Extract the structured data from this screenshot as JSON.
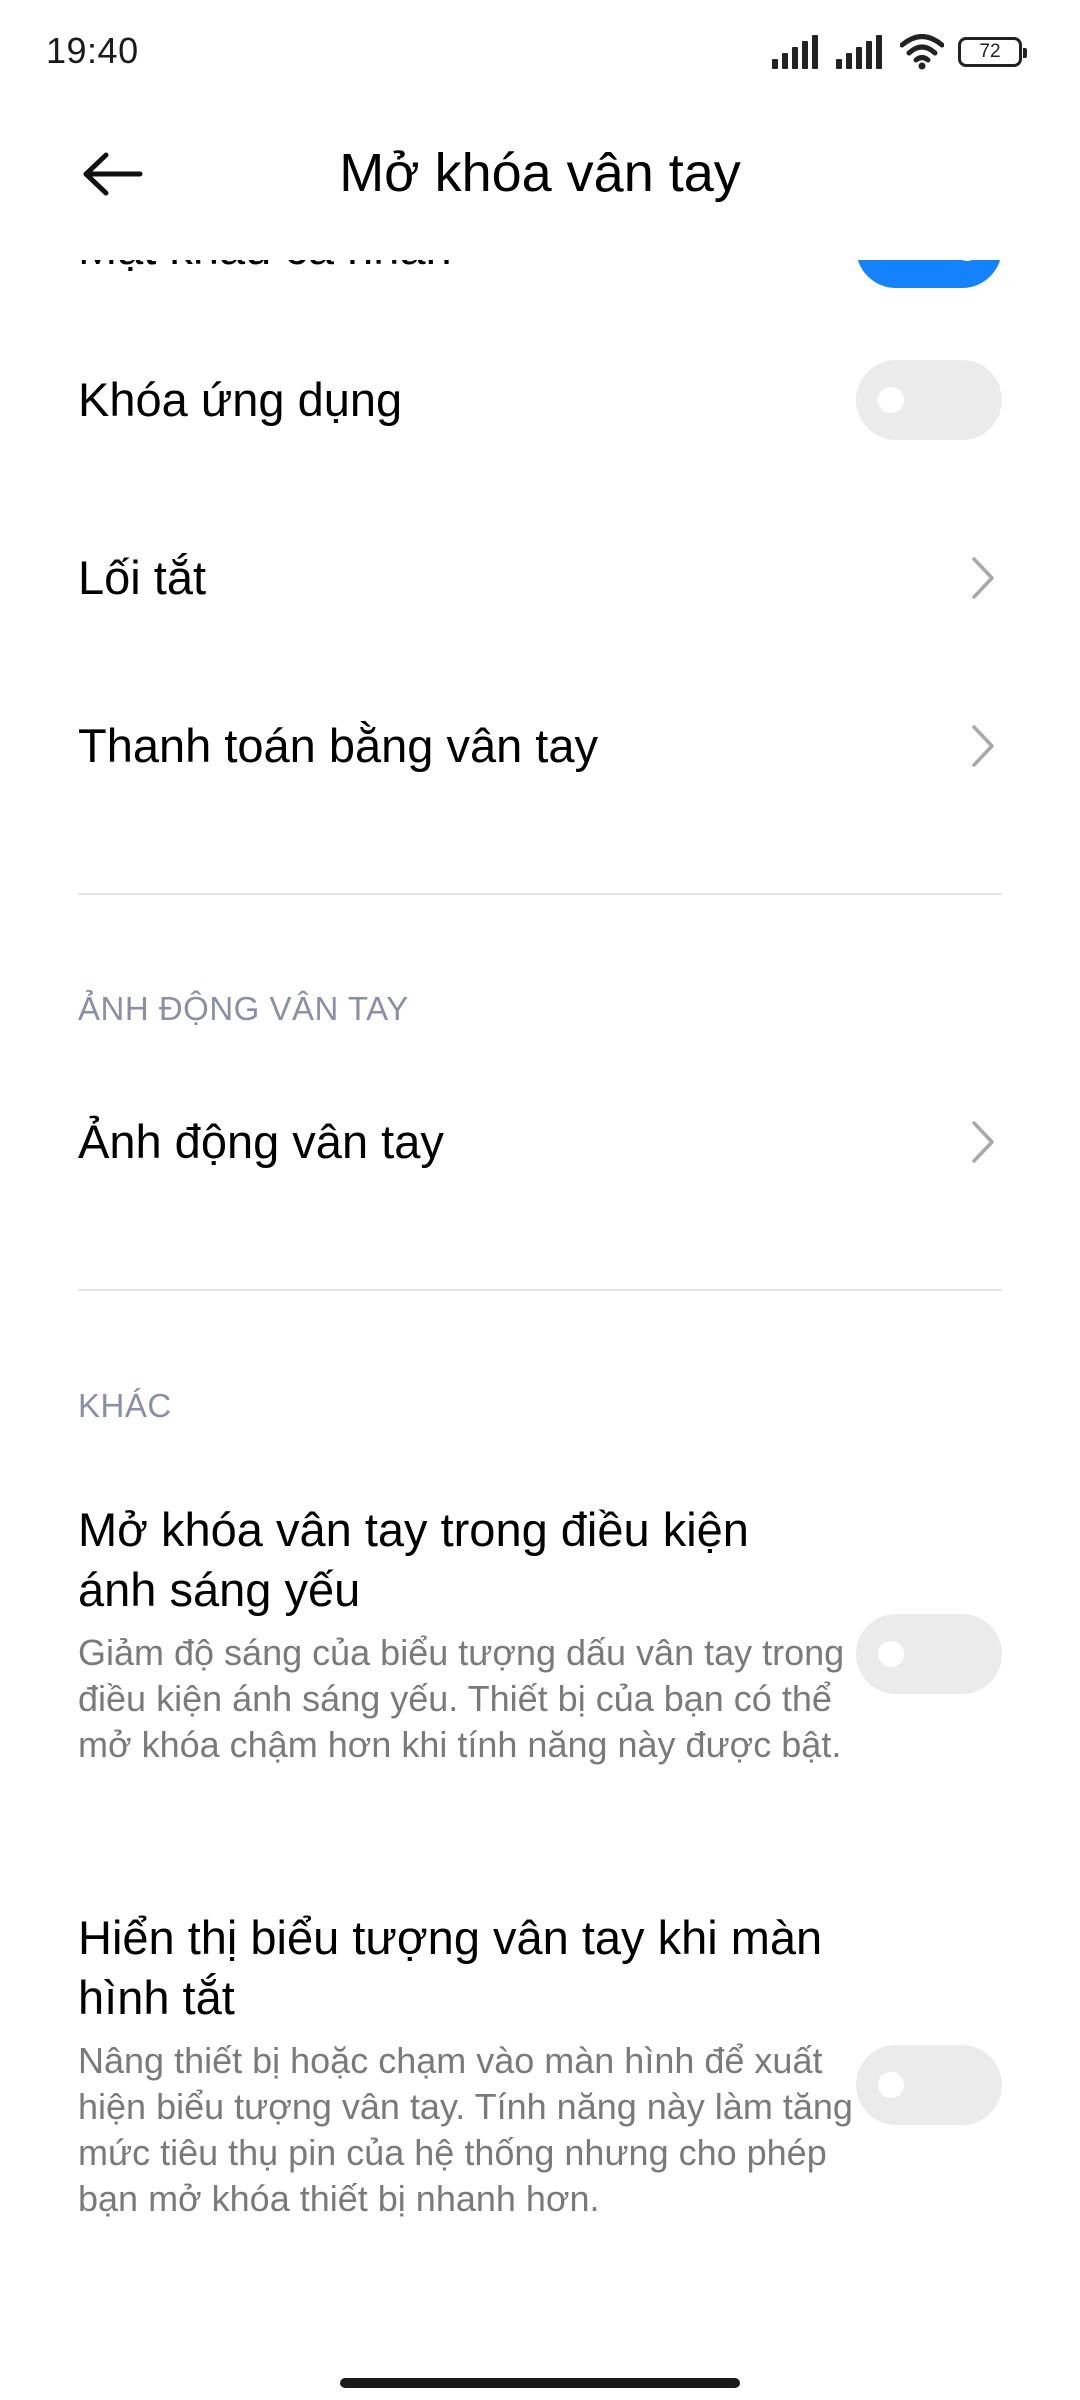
{
  "status_bar": {
    "time": "19:40",
    "battery_level": "72",
    "icons": [
      "signal-icon",
      "signal-icon",
      "wifi-icon",
      "battery-icon"
    ]
  },
  "header": {
    "back_icon": "back-arrow-icon",
    "title": "Mở khóa vân tay"
  },
  "items": {
    "personal_password": {
      "label": "Mật khẩu cá nhân",
      "toggle_on": true
    },
    "app_lock": {
      "label": "Khóa ứng dụng",
      "toggle_on": false
    },
    "shortcuts": {
      "label": "Lối tắt"
    },
    "fingerprint_payment": {
      "label": "Thanh toán bằng vân tay"
    }
  },
  "section_animation": {
    "header": "ẢNH ĐỘNG VÂN TAY",
    "item_label": "Ảnh động vân tay"
  },
  "section_other": {
    "header": "KHÁC",
    "low_light": {
      "title": "Mở khóa vân tay trong điều kiện ánh sáng yếu",
      "description": "Giảm độ sáng của biểu tượng dấu vân tay trong điều kiện ánh sáng yếu. Thiết bị của bạn có thể mở khóa chậm hơn khi tính năng này được bật.",
      "toggle_on": false
    },
    "screen_off_icon": {
      "title": "Hiển thị biểu tượng vân tay khi màn hình tắt",
      "description": "Nâng thiết bị hoặc chạm vào màn hình để xuất hiện biểu tượng vân tay. Tính năng này làm tăng mức tiêu thụ pin của hệ thống nhưng cho phép bạn mở khóa thiết bị nhanh hơn.",
      "toggle_on": false
    }
  },
  "colors": {
    "toggle_on": "#1482fa",
    "toggle_off": "#ebebeb",
    "section_header": "#8a8fa8",
    "description": "#7a7a7a"
  }
}
